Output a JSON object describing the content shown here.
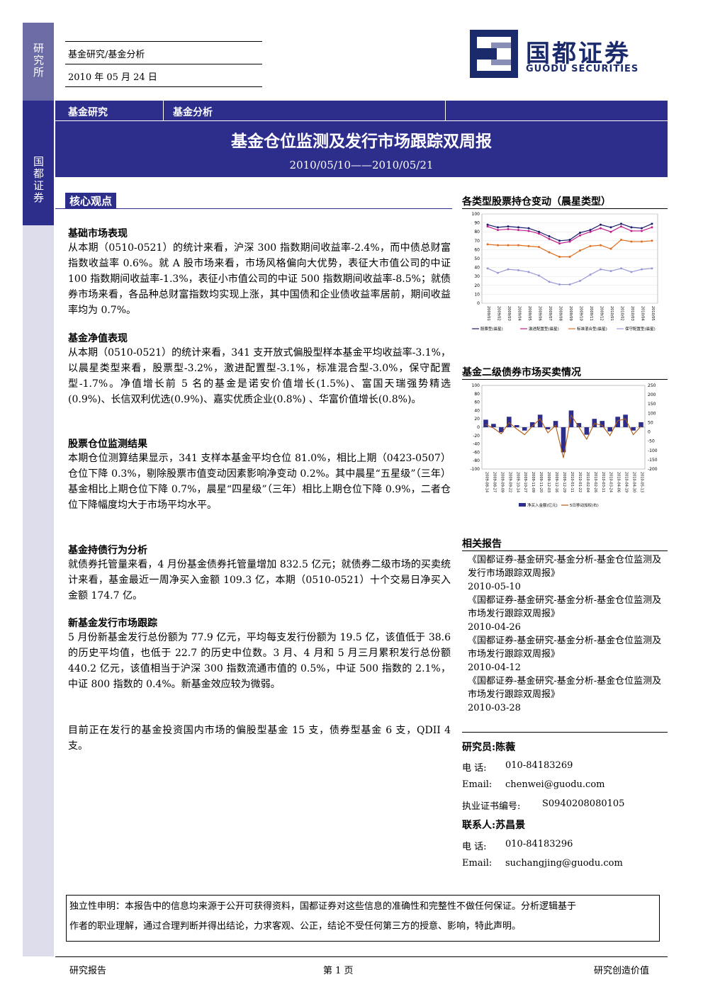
{
  "sidebar": {
    "top_label": "研究所",
    "band_label": "国都证券"
  },
  "header": {
    "category": "基金研究/基金分析",
    "date": "2010 年 05 月 24 日"
  },
  "logo": {
    "name_cn": "国都证券",
    "name_en": "GUODU SECURITIES"
  },
  "banner": {
    "tag1": "基金研究",
    "tag2": "基金分析",
    "title": "基金仓位监测及发行市场跟踪双周报",
    "dates": "2010/05/10——2010/05/21"
  },
  "core_label": "核心观点",
  "sections": [
    {
      "heading": "基础市场表现",
      "text": "从本期（0510-0521）的统计来看，沪深 300 指数期间收益率-2.4%，而中债总财富指数收益率 0.6%。就 A 股市场来看，市场风格偏向大优势，表征大市值公司的中证 100 指数期间收益率-1.3%，表征小市值公司的中证 500 指数期间收益率-8.5%；就债券市场来看，各品种总财富指数均实现上涨，其中国债和企业债收益率居前，期间收益率均为 0.7%。"
    },
    {
      "heading": "基金净值表现",
      "text": "从本期（0510-0521）的统计来看，341 支开放式偏股型样本基金平均收益率-3.1%，以晨星类型来看，股票型-3.2%，激进配置型-3.1%，标准混合型-3.0%，保守配置型-1.7%。净值增长前 5 名的基金是诺安价值增长(1.5%)、富国天瑞强势精选(0.9%)、长信双利优选(0.9%)、嘉实优质企业(0.8%) 、华富价值增长(0.8%)。"
    },
    {
      "heading": "股票仓位监测结果",
      "text": "本期仓位测算结果显示，341 支样本基金平均仓位 81.0%，相比上期（0423-0507）仓位下降 0.3%，剔除股票市值变动因素影响净变动 0.2%。其中晨星“五星级”（三年）基金相比上期仓位下降 0.7%，晨星“四星级”（三年）相比上期仓位下降 0.9%，二者仓位下降幅度均大于市场平均水平。"
    },
    {
      "heading": "基金持债行为分析",
      "text": "就债券托管量来看，4 月份基金债券托管量增加 832.5 亿元；就债券二级市场的买卖统计来看，基金最近一周净买入金额 109.3 亿，本期（0510-0521）十个交易日净买入金额 174.7 亿。"
    },
    {
      "heading": "新基金发行市场跟踪",
      "text": "5 月份新基金发行总份额为 77.9 亿元，平均每支发行份额为 19.5 亿，该值低于 38.6 的历史平均值，也低于 22.7 的历史中位数。3 月、4 月和 5 月三月累积发行总份额 440.2 亿元，该值相当于沪深 300 指数流通市值的 0.5%，中证 500 指数的 2.1%，中证 800 指数的 0.4%。新基金效应较为微弱。"
    }
  ],
  "closing_text": "目前正在发行的基金投资国内市场的偏股型基金 15 支，债券型基金 6 支，QDII 4 支。",
  "chart_data": [
    {
      "type": "line",
      "title": "各类型股票持仓变动（晨星类型）",
      "ylim": [
        0,
        100
      ],
      "y_ticks": [
        "100",
        "90",
        "80",
        "70",
        "60",
        "50",
        "40",
        "30",
        "20",
        "10",
        "0"
      ],
      "x": [
        "2009/01",
        "2009/02",
        "2009/03",
        "2009/04",
        "2009/05",
        "2009/06",
        "2009/07",
        "2009/08",
        "2009/09",
        "2009/10",
        "2009/11",
        "2009/12",
        "2010/01",
        "2010/02",
        "2010/03",
        "2010/04",
        "2010/05"
      ],
      "series": [
        {
          "name": "股票型(晨星)",
          "color": "#1a1a6e",
          "values": [
            88,
            85,
            86,
            85,
            84,
            80,
            75,
            70,
            71,
            79,
            82,
            88,
            85,
            89,
            85,
            84,
            89
          ]
        },
        {
          "name": "激进配置型(晨星)",
          "color": "#c21f8a",
          "values": [
            86,
            82,
            83,
            82,
            81,
            78,
            72,
            67,
            69,
            76,
            80,
            84,
            80,
            86,
            81,
            81,
            85
          ]
        },
        {
          "name": "标准混合型(晨星)",
          "color": "#e07020",
          "values": [
            66,
            65,
            65,
            65,
            64,
            63,
            57,
            52,
            52,
            59,
            64,
            65,
            61,
            71,
            69,
            69,
            70
          ]
        },
        {
          "name": "保守配置型(晨星)",
          "color": "#9a9ad8",
          "values": [
            39,
            34,
            38,
            37,
            35,
            31,
            24,
            21,
            21,
            25,
            32,
            38,
            36,
            39,
            35,
            38,
            39
          ]
        }
      ],
      "legend": "bottom"
    },
    {
      "type": "bar",
      "title": "基金二级债券市场买卖情况",
      "ylim": [
        -100,
        100
      ],
      "y2lim": [
        -200,
        250
      ],
      "y_ticks": [
        "100",
        "80",
        "60",
        "40",
        "20",
        "0",
        "-20",
        "-40",
        "-60",
        "-80",
        "-100"
      ],
      "y2_ticks": [
        "250",
        "200",
        "150",
        "100",
        "50",
        "0",
        "-50",
        "-100",
        "-150",
        "-200"
      ],
      "x": [
        "2009-08-14",
        "2009-08-27",
        "2009-09-09",
        "2009-09-22",
        "2009-10-14",
        "2009-10-27",
        "2009-11-09",
        "2009-11-20",
        "2009-12-03",
        "2009-12-16",
        "2009-12-29",
        "2010-01-11",
        "2010-01-22",
        "2010-02-04",
        "2010-02-26",
        "2010-03-11",
        "2010-03-24",
        "2010-04-06",
        "2010-04-19",
        "2010-04-30",
        "2010-05-13"
      ],
      "series": [
        {
          "name": "净买入金额(亿元)",
          "color": "#2d2d8c",
          "values": [
            18,
            8,
            -12,
            25,
            5,
            -8,
            12,
            30,
            -5,
            15,
            -60,
            40,
            10,
            -18,
            20,
            15,
            -10,
            25,
            30,
            -8,
            12
          ]
        },
        {
          "name": "5日移动加权(右)",
          "color": "#b05a10",
          "values": [
            40,
            20,
            -10,
            50,
            15,
            -15,
            30,
            70,
            -5,
            35,
            -140,
            90,
            25,
            -40,
            45,
            35,
            -20,
            60,
            70,
            -15,
            30
          ]
        }
      ],
      "legend": "bottom"
    }
  ],
  "related": {
    "title": "相关报告",
    "items": [
      {
        "title": "《国都证券-基金研究-基金分析-基金仓位监测及发行市场跟踪双周报》",
        "date": "2010-05-10"
      },
      {
        "title": "《国都证券-基金研究-基金分析-基金仓位监测及市场发行跟踪双周报》",
        "date": "2010-04-26"
      },
      {
        "title": "《国都证券-基金研究-基金分析-基金仓位监测及市场发行跟踪双周报》",
        "date": "2010-04-12"
      },
      {
        "title": "《国都证券-基金研究-基金分析-基金仓位监测及市场发行跟踪双周报》",
        "date": "2010-03-28"
      }
    ]
  },
  "researcher": {
    "label": "研究员:陈薇",
    "phone_label": "电 话:",
    "phone": "010-84183269",
    "email_label": "Email:",
    "email": "chenwei@guodu.com",
    "cert_label": "执业证书编号:",
    "cert": "S0940208080105"
  },
  "contact": {
    "label": "联系人:苏昌景",
    "phone_label": "电 话:",
    "phone": "010-84183296",
    "email_label": "Email:",
    "email": "suchangjing@guodu.com"
  },
  "disclaimer": {
    "line1": "独立性申明：本报告中的信息均来源于公开可获得资料，国都证券对这些信息的准确性和完整性不做任何保证。分析逻辑基于",
    "line2": "作者的职业理解，通过合理判断并得出结论，力求客观、公正，结论不受任何第三方的授意、影响，特此声明。"
  },
  "footer": {
    "left": "研究报告",
    "center": "第 1 页",
    "right": "研究创造价值"
  }
}
